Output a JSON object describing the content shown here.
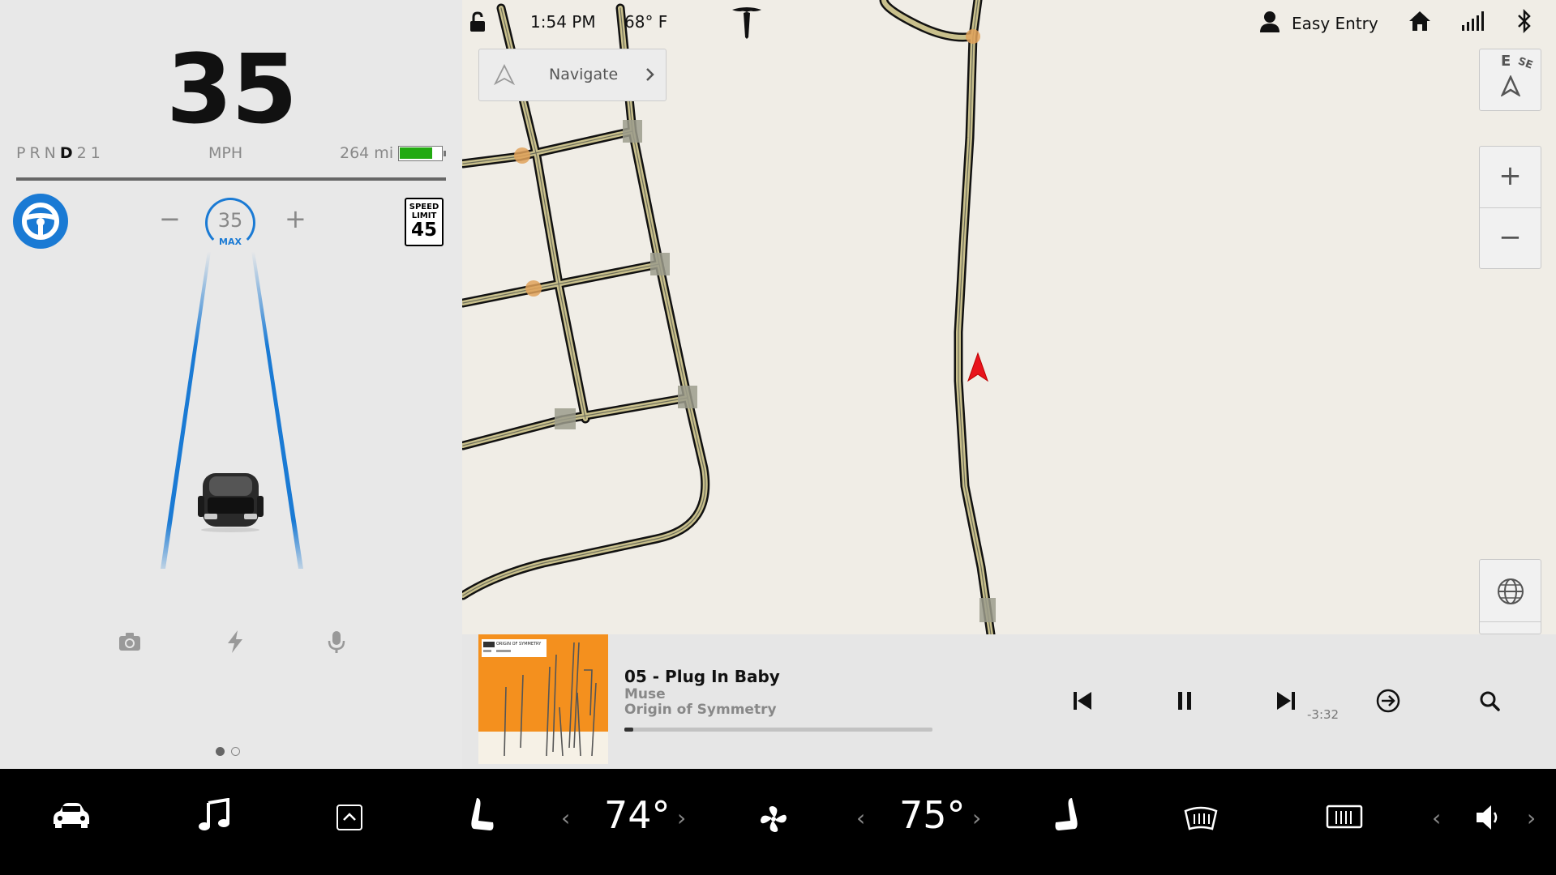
{
  "cluster": {
    "speed": "35",
    "gears": [
      "P",
      "R",
      "N",
      "D",
      "2",
      "1"
    ],
    "active_gear": "D",
    "speed_unit": "MPH",
    "range": "264 mi",
    "battery_level": 0.78,
    "cruise": {
      "minus": "−",
      "plus": "+",
      "set_speed": "35",
      "max_label": "MAX"
    },
    "speed_limit": {
      "label_line1": "SPEED",
      "label_line2": "LIMIT",
      "value": "45"
    },
    "quick_icons": [
      "camera-icon",
      "lightning-icon",
      "microphone-icon"
    ],
    "page_dots": {
      "count": 2,
      "active": 0
    }
  },
  "status": {
    "time": "1:54 PM",
    "temperature": "68° F",
    "profile": "Easy Entry"
  },
  "map": {
    "navigate_label": "Navigate",
    "compass": {
      "primary": "E",
      "secondary": "SE"
    },
    "zoom_in": "+",
    "zoom_out": "−"
  },
  "media": {
    "track": "05 - Plug In Baby",
    "artist": "Muse",
    "album": "Origin of Symmetry",
    "remaining": "-3:32",
    "progress": 0.03,
    "cover_text": "ORIGIN OF SYMMETRY"
  },
  "climate": {
    "driver_temp": "74°",
    "passenger_temp": "75°"
  },
  "colors": {
    "accent_blue": "#1a7ad4",
    "battery_green": "#22aa11",
    "nav_arrow_red": "#e8141c",
    "album_orange": "#f4901e"
  }
}
